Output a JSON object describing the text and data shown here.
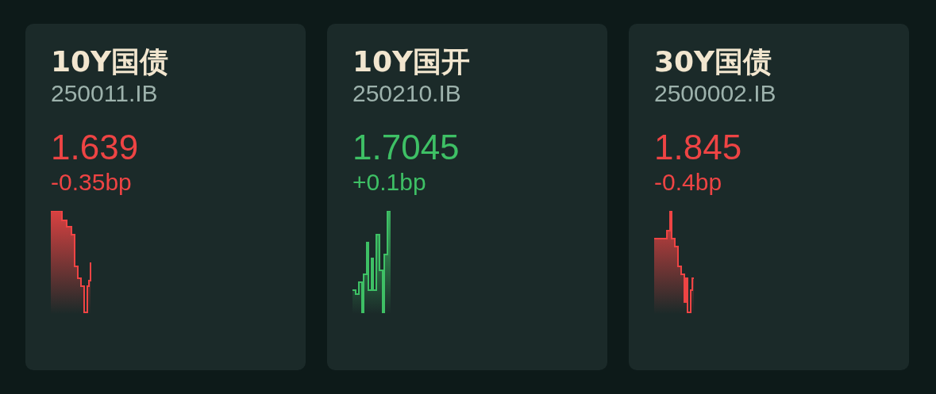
{
  "quotes": [
    {
      "name": "10Y国债",
      "code": "250011.IB",
      "price": "1.639",
      "change": "-0.35bp",
      "color": "#ee4444"
    },
    {
      "name": "10Y国开",
      "code": "250210.IB",
      "price": "1.7045",
      "change": "+0.1bp",
      "color": "#3ec065"
    },
    {
      "name": "30Y国债",
      "code": "2500002.IB",
      "price": "1.845",
      "change": "-0.4bp",
      "color": "#ee4444"
    }
  ]
}
